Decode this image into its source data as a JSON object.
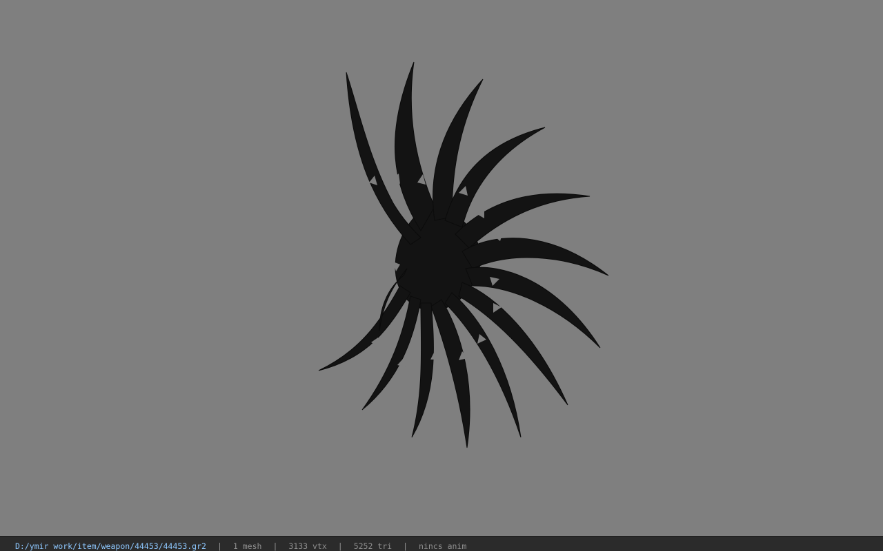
{
  "viewport": {
    "background_color": "#7f7f7f",
    "model_color": "#121212",
    "model": "spiral-blade-fan"
  },
  "statusbar": {
    "file_path": "D:/ymir work/item/weapon/44453/44453.gr2",
    "separator": "|",
    "mesh_count": "1 mesh",
    "vertex_count": "3133 vtx",
    "triangle_count": "5252 tri",
    "anim_status": "nincs anim",
    "path_color": "#8ec8ff",
    "text_color": "#8f8f8f"
  }
}
